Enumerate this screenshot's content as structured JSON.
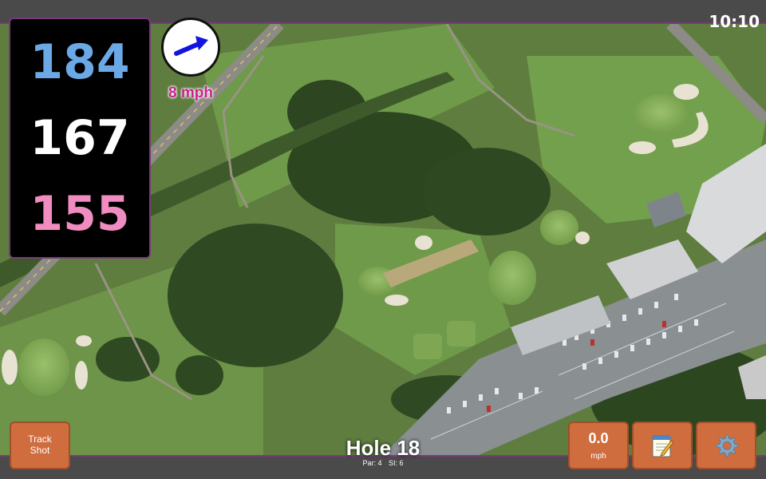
{
  "status": {
    "time": "10:10"
  },
  "distances": {
    "back": "184",
    "middle": "167",
    "front": "155"
  },
  "wind": {
    "speed_label": "8 mph",
    "direction_icon": "wind-arrow-icon"
  },
  "hole": {
    "title": "Hole 18",
    "par": "Par: 4",
    "si": "SI: 6"
  },
  "buttons": {
    "track_shot_line1": "Track",
    "track_shot_line2": "Shot",
    "speed_value": "0.0",
    "speed_unit": "mph",
    "notes_icon": "notepad-icon",
    "settings_icon": "gear-icon"
  },
  "colors": {
    "back_distance": "#6aa9e6",
    "middle_distance": "#ffffff",
    "front_distance": "#f08cc0",
    "wind_label": "#c8238f",
    "button_bg": "#cf6d3f",
    "frame_accent": "#7a3a7a"
  }
}
